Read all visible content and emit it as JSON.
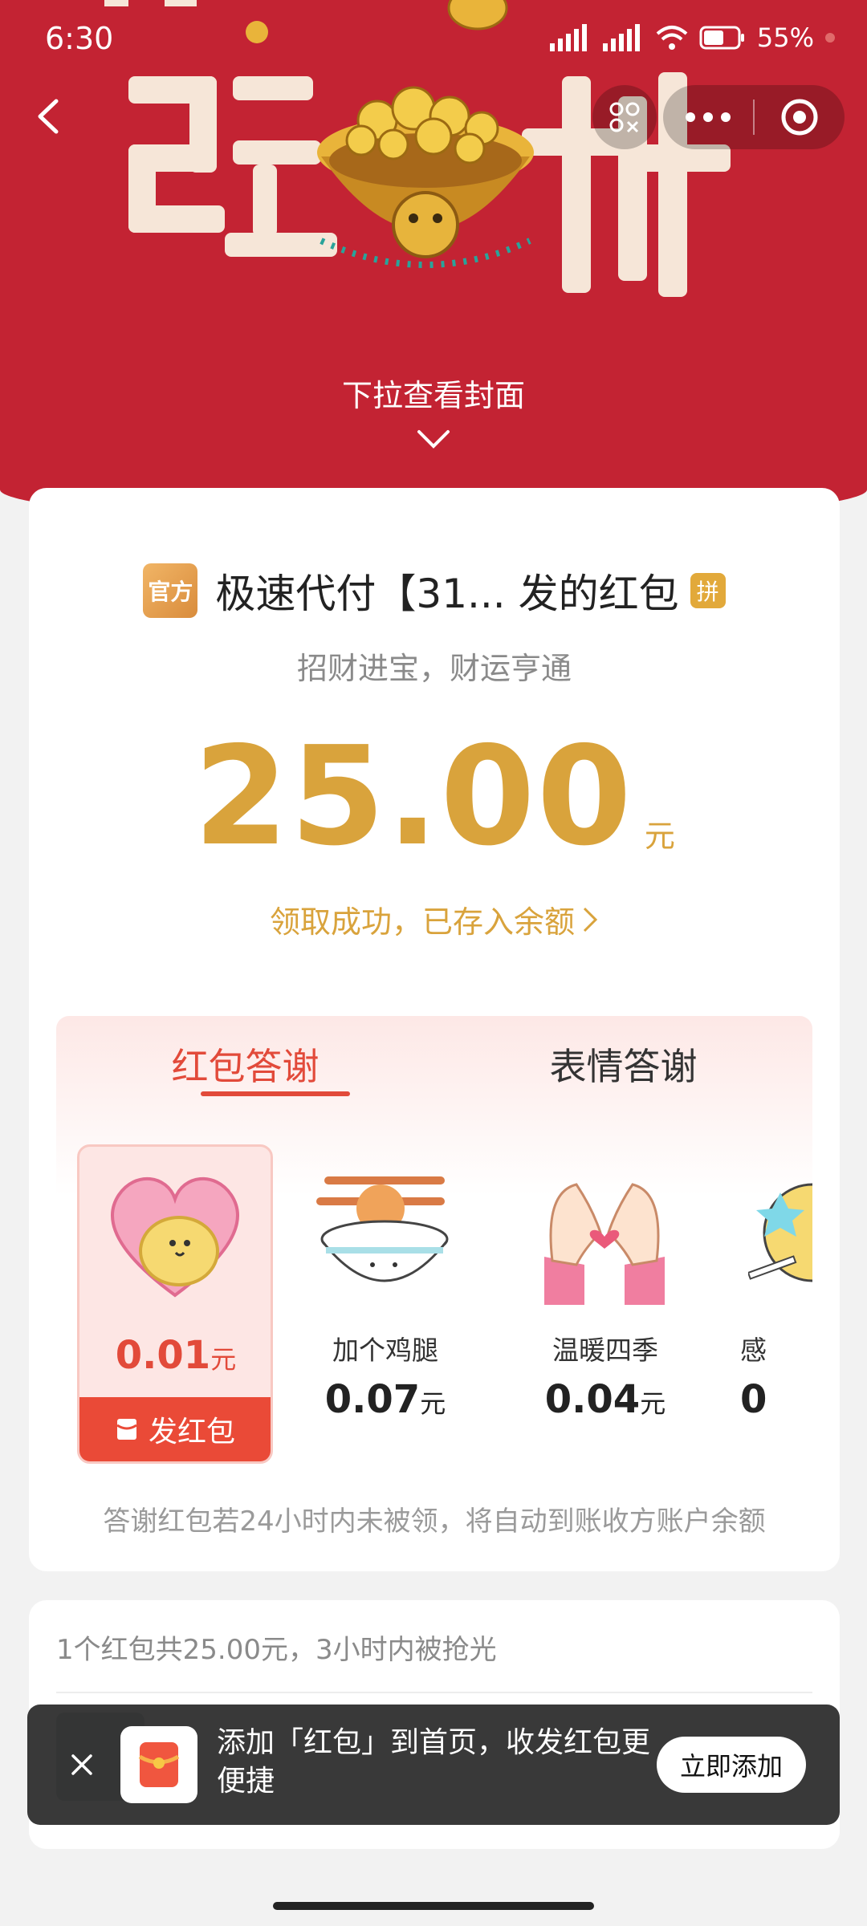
{
  "status_bar": {
    "time": "6:30",
    "battery": "55%"
  },
  "header": {
    "pull_hint": "下拉查看封面"
  },
  "card": {
    "official_badge": "官方",
    "sender": "极速代付【31... 发的红包",
    "pin_badge": "拼",
    "blessing": "招财进宝，财运亨通",
    "amount": "25.00",
    "amount_unit": "元",
    "status": "领取成功，已存入余额"
  },
  "thanks": {
    "tabs": [
      {
        "label": "红包答谢"
      },
      {
        "label": "表情答谢"
      }
    ],
    "items": [
      {
        "name": "",
        "price": "0.01",
        "unit": "元",
        "send_label": "发红包"
      },
      {
        "name": "加个鸡腿",
        "price": "0.07",
        "unit": "元"
      },
      {
        "name": "温暖四季",
        "price": "0.04",
        "unit": "元"
      },
      {
        "name": "感",
        "price": "0",
        "unit": ""
      }
    ],
    "note": "答谢红包若24小时内未被领，将自动到账收方账户余额"
  },
  "summary": {
    "text": "1个红包共25.00元，3小时内被抢光"
  },
  "toast": {
    "text": "添加「红包」到首页，收发红包更便捷",
    "button": "立即添加"
  },
  "colors": {
    "header_red": "#c32333",
    "gold": "#d9a33c",
    "accent_red": "#e24a3a"
  }
}
